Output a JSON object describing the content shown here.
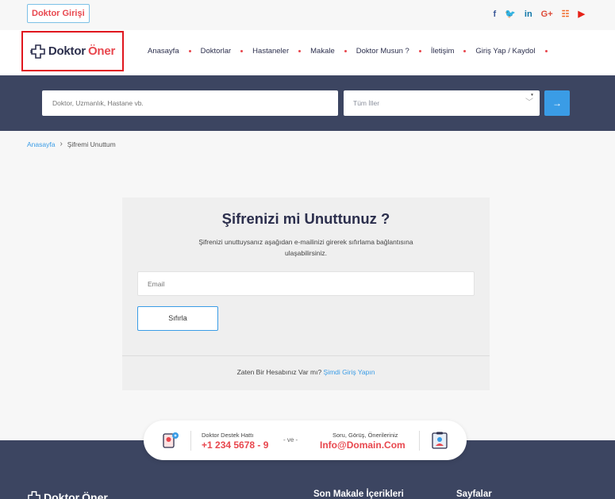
{
  "topbar": {
    "doctor_login": "Doktor Girişi",
    "social": [
      {
        "icon": "facebook-icon",
        "glyph": "f",
        "color": "#3b5998"
      },
      {
        "icon": "twitter-icon",
        "glyph": "🐦",
        "color": "#1da1f2"
      },
      {
        "icon": "linkedin-icon",
        "glyph": "in",
        "color": "#0e76a8"
      },
      {
        "icon": "google-plus-icon",
        "glyph": "G+",
        "color": "#dd4b39"
      },
      {
        "icon": "rss-icon",
        "glyph": "☷",
        "color": "#f26522"
      },
      {
        "icon": "youtube-icon",
        "glyph": "▶",
        "color": "#e62117"
      }
    ]
  },
  "logo": {
    "part1": "Doktor",
    "part2": "Öner"
  },
  "nav": {
    "items": [
      "Anasayfa",
      "Doktorlar",
      "Hastaneler",
      "Makale",
      "Doktor Musun ?",
      "İletişim",
      "Giriş Yap / Kaydol"
    ]
  },
  "search": {
    "placeholder": "Doktor, Uzmanlık, Hastane vb.",
    "city_selected": "Tüm İller"
  },
  "breadcrumb": {
    "home": "Anasayfa",
    "current": "Şifremi Unuttum"
  },
  "card": {
    "title": "Şifrenizi mi Unuttunuz ?",
    "description": "Şifrenizi unuttuysanız aşağıdan e-mailinizi girerek sıfırlama bağlantısına ulaşabilirsiniz.",
    "email_placeholder": "Email",
    "reset_label": "Sıfırla",
    "footer_text": "Zaten Bir Hesabınız Var mı?",
    "footer_link": "Şimdi Giriş Yapın"
  },
  "support": {
    "hotline_label": "Doktor Destek Hattı",
    "hotline_value": "+1 234 5678 - 9",
    "or_text": "- ve -",
    "contact_label": "Soru, Görüş, Önerileriniz",
    "contact_value": "Info@Domain.Com"
  },
  "footer": {
    "logo_part1": "Doktor",
    "logo_part2": "Öner",
    "col_articles": "Son Makale İçerikleri",
    "col_pages": "Sayfalar"
  },
  "colors": {
    "accent_blue": "#3a9ce6",
    "brand_red": "#e8474e",
    "navy": "#3c4561"
  }
}
